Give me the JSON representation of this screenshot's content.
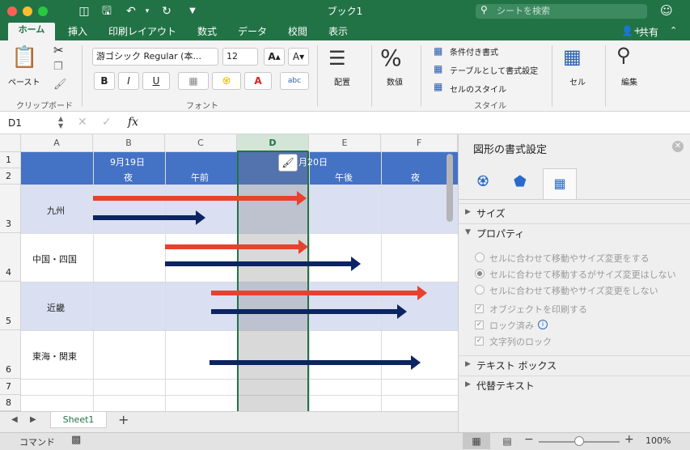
{
  "app": {
    "title": "ブック1",
    "search_placeholder": "シートを検索",
    "share_label": "共有",
    "brand_color": "#217346"
  },
  "tabs": [
    "ホーム",
    "挿入",
    "印刷レイアウト",
    "数式",
    "データ",
    "校閲",
    "表示"
  ],
  "ribbon": {
    "paste": "ペースト",
    "clipboard": "クリップボード",
    "font_name": "游ゴシック Regular (本...",
    "font_size": "12",
    "bold": "B",
    "italic": "I",
    "underline": "U",
    "font_group": "フォント",
    "align": "配置",
    "number": "数値",
    "number_symbol": "%",
    "cond_format": "条件付き書式",
    "table_format": "テーブルとして書式設定",
    "cell_style": "セルのスタイル",
    "style_group": "スタイル",
    "cells": "セル",
    "edit": "編集"
  },
  "formula": {
    "namebox": "D1",
    "fx": "fx",
    "value": ""
  },
  "grid": {
    "columns": [
      "A",
      "B",
      "C",
      "D",
      "E",
      "F"
    ],
    "rows": [
      "1",
      "2",
      "3",
      "4",
      "5",
      "6",
      "7",
      "8"
    ],
    "selected_column": "D",
    "date1": "9月19日",
    "date2": "9月20日",
    "slot_night1": "夜",
    "slot_am": "午前",
    "slot_pm": "午後",
    "slot_night2": "夜",
    "regions": [
      "九州",
      "中国・四国",
      "近畿",
      "東海・関東"
    ],
    "header_color": "#4472c4",
    "band_color": "#dae0f2",
    "arrow_red": "#e8412e",
    "arrow_navy": "#0c2461"
  },
  "arrows": [
    {
      "region": "九州",
      "color": "red",
      "start": 0,
      "end": 2.95
    },
    {
      "region": "九州",
      "color": "navy",
      "start": 0,
      "end": 1.55
    },
    {
      "region": "中国・四国",
      "color": "red",
      "start": 1,
      "end": 2.95
    },
    {
      "region": "中国・四国",
      "color": "navy",
      "start": 1,
      "end": 3.7
    },
    {
      "region": "近畿",
      "color": "red",
      "start": 1.65,
      "end": 4.6
    },
    {
      "region": "近畿",
      "color": "navy",
      "start": 1.65,
      "end": 4.35
    },
    {
      "region": "東海・関東",
      "color": "navy",
      "start": 1.6,
      "end": 4.55
    }
  ],
  "panel": {
    "title": "図形の書式設定",
    "size_section": "サイズ",
    "props_section": "プロパティ",
    "options": [
      "セルに合わせて移動やサイズ変更をする",
      "セルに合わせて移動するがサイズ変更はしない",
      "セルに合わせて移動やサイズ変更をしない"
    ],
    "checks": [
      "オブジェクトを印刷する",
      "ロック済み",
      "文字列のロック"
    ],
    "textbox_section": "テキスト ボックス",
    "alt_section": "代替テキスト"
  },
  "sheet": {
    "tab": "Sheet1",
    "add": "+"
  },
  "status": {
    "mode": "コマンド",
    "zoom": "100%"
  }
}
